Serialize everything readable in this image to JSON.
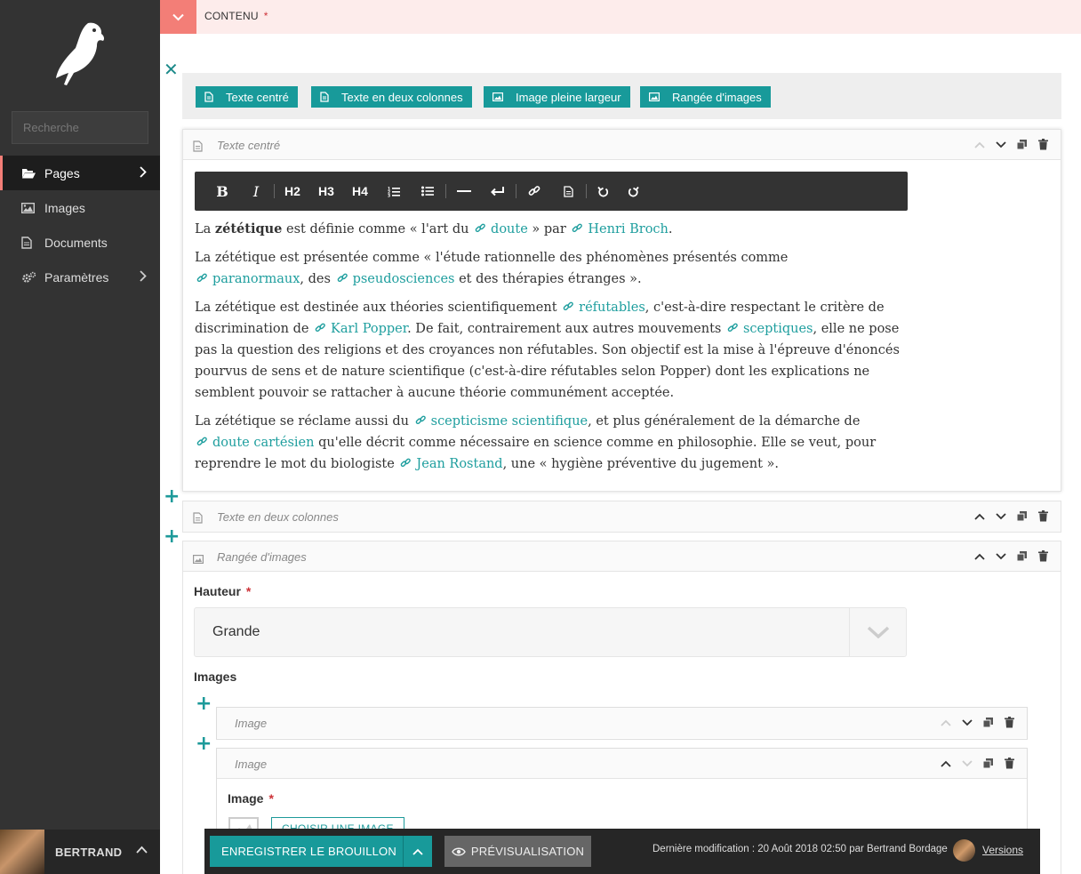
{
  "sidebar": {
    "logo": "wagtail-bird-icon",
    "search_placeholder": "Recherche",
    "items": [
      {
        "label": "Pages",
        "icon": "folder-open-icon"
      },
      {
        "label": "Images",
        "icon": "image-icon"
      },
      {
        "label": "Documents",
        "icon": "doc-icon"
      },
      {
        "label": "Paramètres",
        "icon": "cogs-icon"
      }
    ],
    "account_name": "BERTRAND"
  },
  "field": {
    "label": "CONTENU",
    "required": "*"
  },
  "add_buttons": [
    "Texte centré",
    "Texte en deux colonnes",
    "Image pleine largeur",
    "Rangée d'images"
  ],
  "block1": {
    "title": "Texte centré",
    "toolbar": [
      "B",
      "I",
      "H2",
      "H3",
      "H4"
    ],
    "p1": {
      "t1": "La ",
      "b1": "zététique",
      "t2": " est définie comme « l'art du ",
      "l1": "doute",
      "t3": " » par ",
      "l2": "Henri Broch",
      "t4": "."
    },
    "p2": {
      "t1": "La zététique est présentée comme « l'étude rationnelle des phénomènes présentés comme ",
      "l1": "paranormaux",
      "t2": ", des ",
      "l2": "pseudosciences",
      "t3": " et des thérapies étranges »."
    },
    "p3": {
      "t1": "La zététique est destinée aux théories scientifiquement ",
      "l1": "réfutables",
      "t2": ", c'est-à-dire respectant le critère de discrimination de ",
      "l2": "Karl Popper",
      "t3": ". De fait, contrairement aux autres mouvements ",
      "l3": "sceptiques",
      "t4": ", elle ne pose pas la question des religions et des croyances non réfutables. Son objectif est la mise à l'épreuve d'énoncés pourvus de sens et de nature scientifique (c'est-à-dire réfutables selon Popper) dont les explications ne semblent pouvoir se rattacher à aucune théorie communément acceptée."
    },
    "p4": {
      "t1": "La zététique se réclame aussi du ",
      "l1": "scepticisme scientifique",
      "t2": ", et plus généralement de la démarche de ",
      "l2": "doute cartésien",
      "t3": " qu'elle décrit comme nécessaire en science comme en philosophie. Elle se veut, pour reprendre le mot du biologiste ",
      "l3": "Jean Rostand",
      "t4": ", une « hygiène préventive du jugement »."
    }
  },
  "block2": {
    "title": "Texte en deux colonnes"
  },
  "block3": {
    "title": "Rangée d'images",
    "height_label": "Hauteur",
    "height_value": "Grande",
    "images_label": "Images",
    "image1_title": "Image",
    "image2_title": "Image",
    "image_field_label": "Image",
    "choose_button": "CHOISIR UNE IMAGE"
  },
  "footer": {
    "save": "ENREGISTRER LE BROUILLON",
    "preview": "PRÉVISUALISATION",
    "meta": "Dernière modification : 20 Août 2018 02:50 par Bertrand Bordage",
    "versions": "Versions"
  },
  "colors": {
    "accent": "#189a9a",
    "primary": "#f37e77",
    "sidebar": "#333333"
  }
}
